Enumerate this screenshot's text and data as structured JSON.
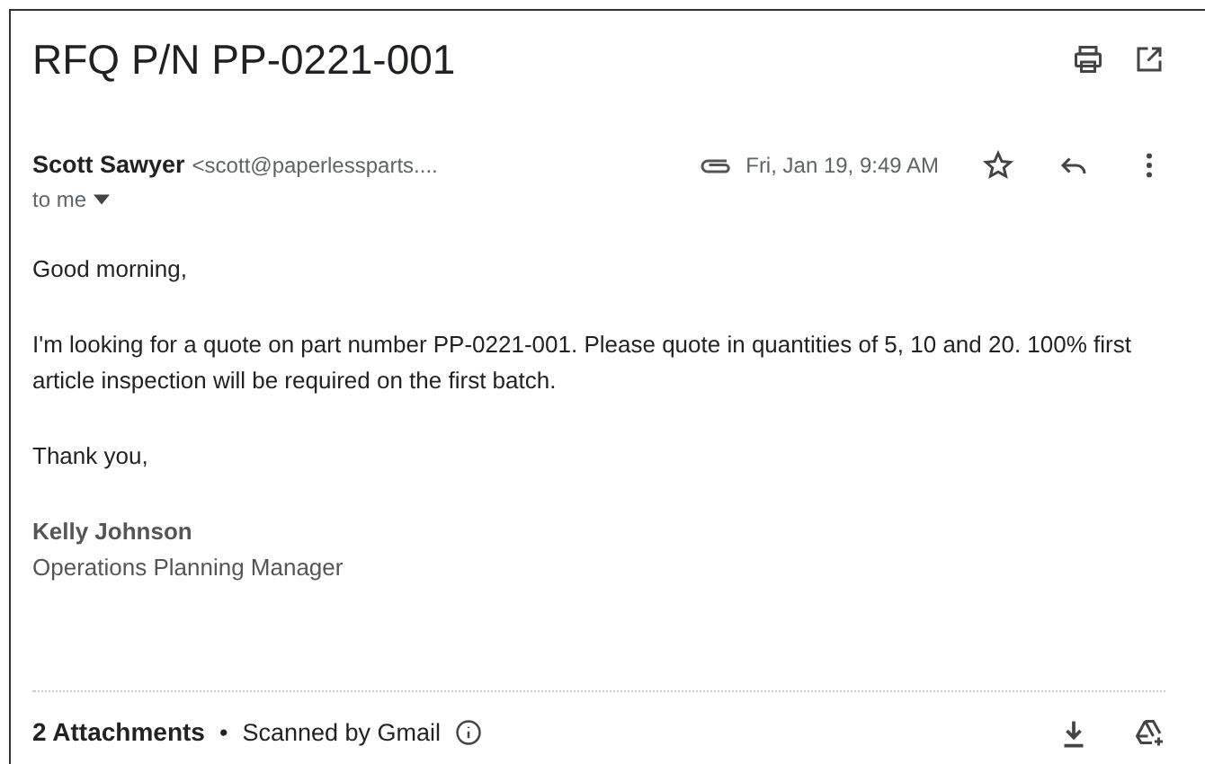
{
  "subject": "RFQ P/N PP-0221-001",
  "message": {
    "sender_name": "Scott Sawyer",
    "sender_email": "<scott@paperlessparts....",
    "has_attachment": true,
    "date": "Fri, Jan 19, 9:49 AM",
    "starred": false,
    "recipient": "to me"
  },
  "body": {
    "paragraphs": [
      "Good morning,",
      "I'm looking for a quote on part number PP-0221-001. Please quote in quantities of 5, 10 and 20. 100% first article inspection will be required on the first batch.",
      "Thank you,"
    ],
    "signature_name": "Kelly Johnson",
    "signature_title": "Operations Planning Manager"
  },
  "attachments": {
    "count_label": "2 Attachments",
    "separator": "•",
    "scan_note": "Scanned by Gmail"
  }
}
